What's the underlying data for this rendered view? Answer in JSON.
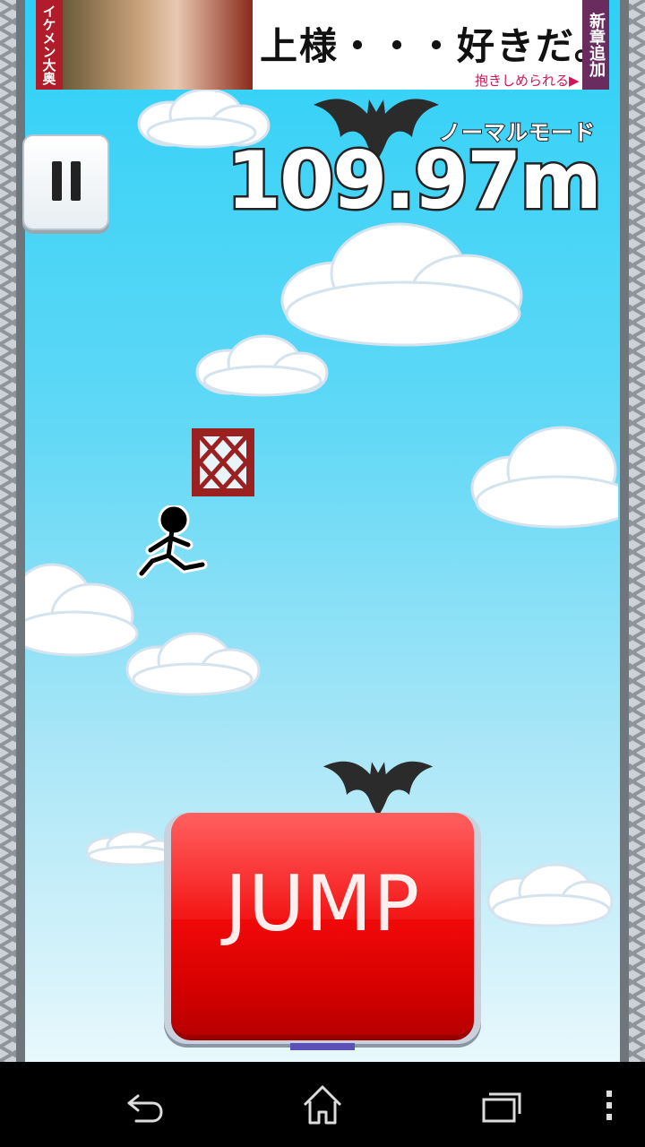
{
  "ad": {
    "left_text": "イケメン大奥",
    "headline": "上様・・・好きだ。",
    "subline": "抱きしめられる▶",
    "right_text": "新章追加"
  },
  "hud": {
    "mode": "ノーマルモード",
    "distance": "109.97m"
  },
  "controls": {
    "jump_label": "JUMP"
  },
  "colors": {
    "sky_top": "#2ed0f7",
    "jump_red": "#f40a0a",
    "crate_red": "#9b2020"
  },
  "icons": {
    "pause": "pause-icon",
    "back": "back-icon",
    "home": "home-icon",
    "recents": "recent-apps-icon",
    "menu": "overflow-menu-icon"
  }
}
